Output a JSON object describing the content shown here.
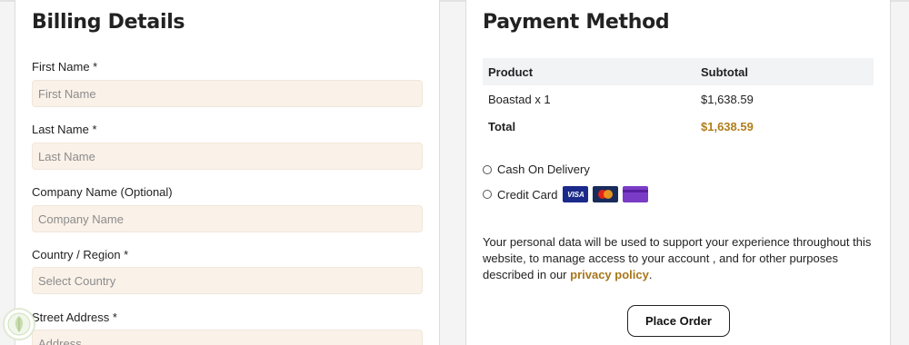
{
  "billing": {
    "title": "Billing Details",
    "fields": [
      {
        "label": "First Name *",
        "placeholder": "First Name",
        "value": ""
      },
      {
        "label": "Last Name *",
        "placeholder": "Last Name",
        "value": ""
      },
      {
        "label": "Company Name (Optional)",
        "placeholder": "Company Name",
        "value": ""
      },
      {
        "label": "Country / Region *",
        "placeholder": "Select Country",
        "value": ""
      },
      {
        "label": "Street Address *",
        "placeholder": "Address",
        "value": ""
      }
    ]
  },
  "payment": {
    "title": "Payment Method",
    "table": {
      "headers": [
        "Product",
        "Subtotal"
      ],
      "rows": [
        {
          "product": "Boastad x 1",
          "subtotal": "$1,638.59"
        }
      ],
      "total_label": "Total",
      "total_value": "$1,638.59"
    },
    "options": [
      {
        "label": "Cash On Delivery",
        "selected": false
      },
      {
        "label": "Credit Card",
        "selected": false
      }
    ],
    "card_icons": [
      "visa-card-icon",
      "mastercard-icon",
      "generic-card-icon"
    ],
    "visa_text": "VISA",
    "privacy_text": "Your personal data will be used to support your experience throughout this website, to manage access to your account , and for other purposes described in our ",
    "privacy_link": "privacy policy",
    "privacy_end": ".",
    "place_order": "Place Order"
  },
  "colors": {
    "accent": "#a8761a",
    "input_bg": "#faf1e8",
    "header_bg": "#f2f3f5"
  },
  "logo_icon": "leaf-shield-logo-icon"
}
